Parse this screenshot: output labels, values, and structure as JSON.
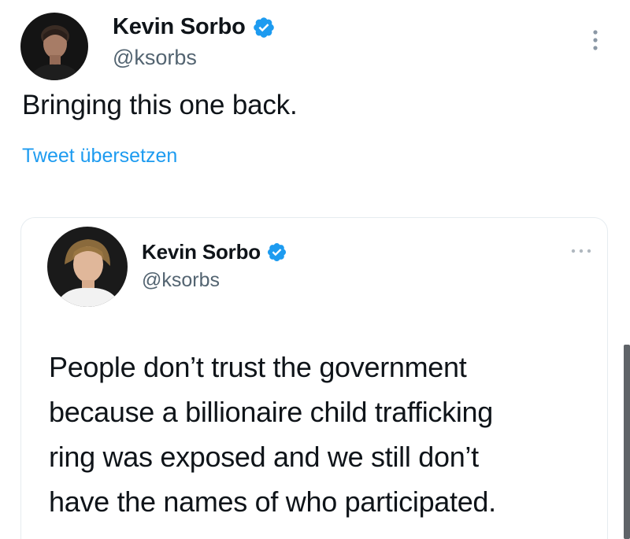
{
  "tweet": {
    "display_name": "Kevin Sorbo",
    "handle": "@ksorbs",
    "text": "Bringing this one back.",
    "translate_label": "Tweet übersetzen"
  },
  "quoted": {
    "display_name": "Kevin Sorbo",
    "handle": "@ksorbs",
    "lines": [
      "People don’t trust the government",
      "because a billionaire child trafficking",
      "ring was exposed and we still don’t",
      "have the names of who participated."
    ]
  },
  "icons": {
    "verified": "verified-badge-icon",
    "more": "more-options-icon"
  },
  "colors": {
    "accent": "#1d9bf0",
    "secondary_text": "#536471",
    "primary_text": "#0f1419"
  }
}
